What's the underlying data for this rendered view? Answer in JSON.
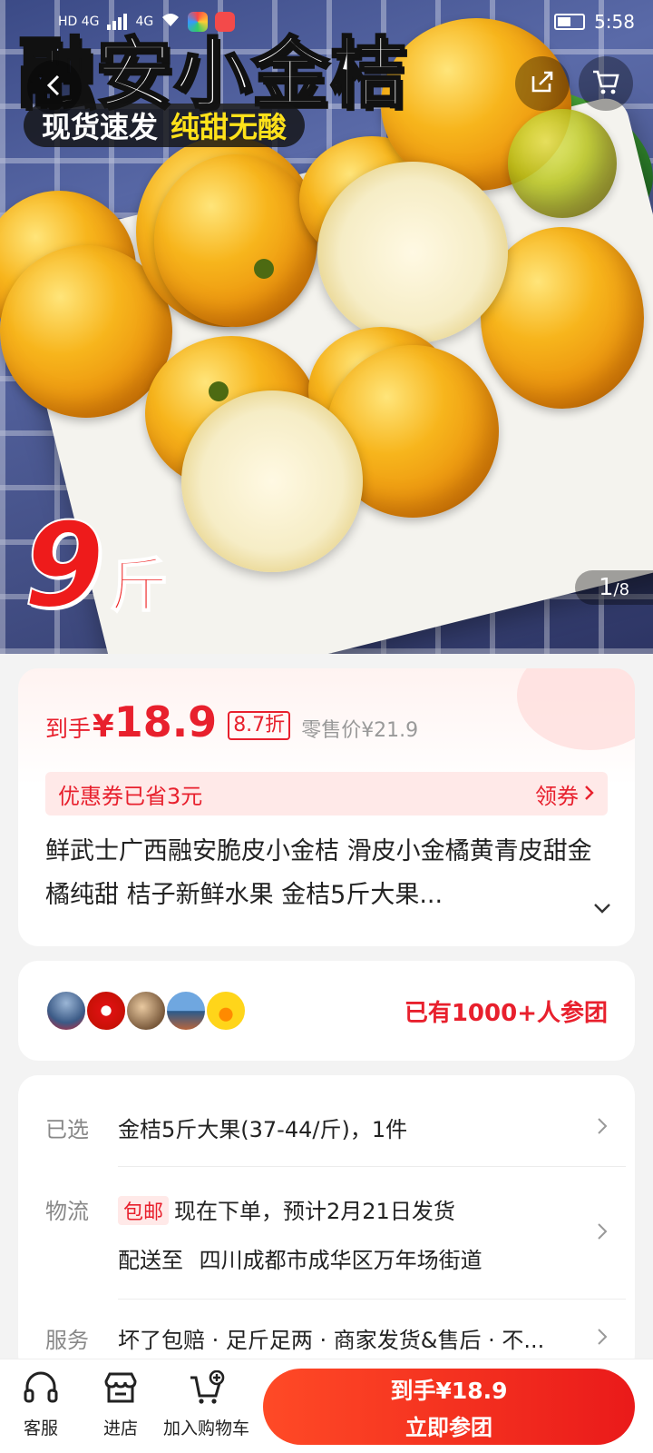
{
  "status_bar": {
    "network_left": "HD 4G",
    "network_right": "4G",
    "time": "5:58"
  },
  "hero": {
    "title": "融安小金桔",
    "tag_left": "现货速发",
    "tag_right": "纯甜无酸",
    "weight_number": "9",
    "weight_unit": "斤",
    "page_current": "1",
    "page_total": "/8"
  },
  "price": {
    "prefix": "到手",
    "currency": "¥",
    "amount": "18.9",
    "discount": "8.7折",
    "retail": "零售价¥21.9"
  },
  "coupon": {
    "text": "优惠券已省3元",
    "action": "领券"
  },
  "product_title": "鲜武士广西融安脆皮小金桔 滑皮小金橘黄青皮甜金橘纯甜 桔子新鲜水果 金桔5斤大果...",
  "group": {
    "text": "已有1000+人参团"
  },
  "info": {
    "selected_label": "已选",
    "selected_value": "金桔5斤大果(37-44/斤)，1件",
    "logistics_label": "物流",
    "logistics_tag": "包邮",
    "logistics_value": "现在下单，预计2月21日发货",
    "delivery_prefix": "配送至",
    "delivery_address": "四川成都市成华区万年场街道",
    "service_label": "服务",
    "service_value": "坏了包赔 · 足斤足两 · 商家发货&售后 · 不..."
  },
  "bottom_bar": {
    "service": "客服",
    "store": "进店",
    "add_cart": "加入购物车",
    "buy_price": "到手¥18.9",
    "buy_action": "立即参团"
  },
  "colors": {
    "accent": "#e8202d",
    "buy_gradient_start": "#ff4a26",
    "buy_gradient_end": "#ea1a1a"
  }
}
